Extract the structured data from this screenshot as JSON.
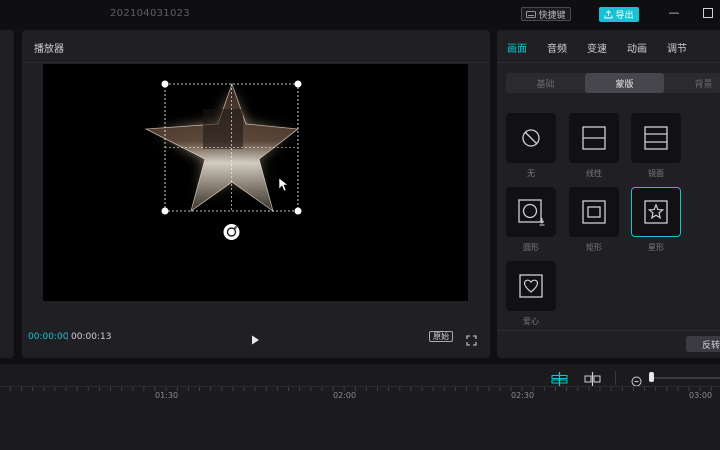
{
  "titlebar": {
    "project_title": "202104031023",
    "shortcut_label": "快捷键",
    "export_label": "导出"
  },
  "player": {
    "title": "播放器",
    "time_current": "00:00:00",
    "time_total": "00:00:13",
    "ratio_label": "原始"
  },
  "inspector": {
    "tabs": [
      {
        "label": "画面",
        "active": true
      },
      {
        "label": "音频"
      },
      {
        "label": "变速"
      },
      {
        "label": "动画"
      },
      {
        "label": "调节"
      }
    ],
    "segments": [
      {
        "label": "基础"
      },
      {
        "label": "蒙版",
        "active": true
      },
      {
        "label": "背景"
      }
    ],
    "masks": [
      {
        "label": "无",
        "icon": "no-mask-icon"
      },
      {
        "label": "线性",
        "icon": "linear-mask-icon"
      },
      {
        "label": "镜面",
        "icon": "mirror-mask-icon"
      },
      {
        "label": "圆形",
        "icon": "circle-mask-icon"
      },
      {
        "label": "矩形",
        "icon": "rectangle-mask-icon"
      },
      {
        "label": "星形",
        "icon": "star-mask-icon",
        "selected": true
      },
      {
        "label": "爱心",
        "icon": "heart-mask-icon"
      }
    ],
    "reverse_label": "反转"
  },
  "timeline": {
    "ruler_labels": [
      "01:30",
      "02:00",
      "02:30",
      "03:00"
    ]
  },
  "colors": {
    "accent": "#19c1d6",
    "panel": "#202024",
    "background": "#101012"
  }
}
